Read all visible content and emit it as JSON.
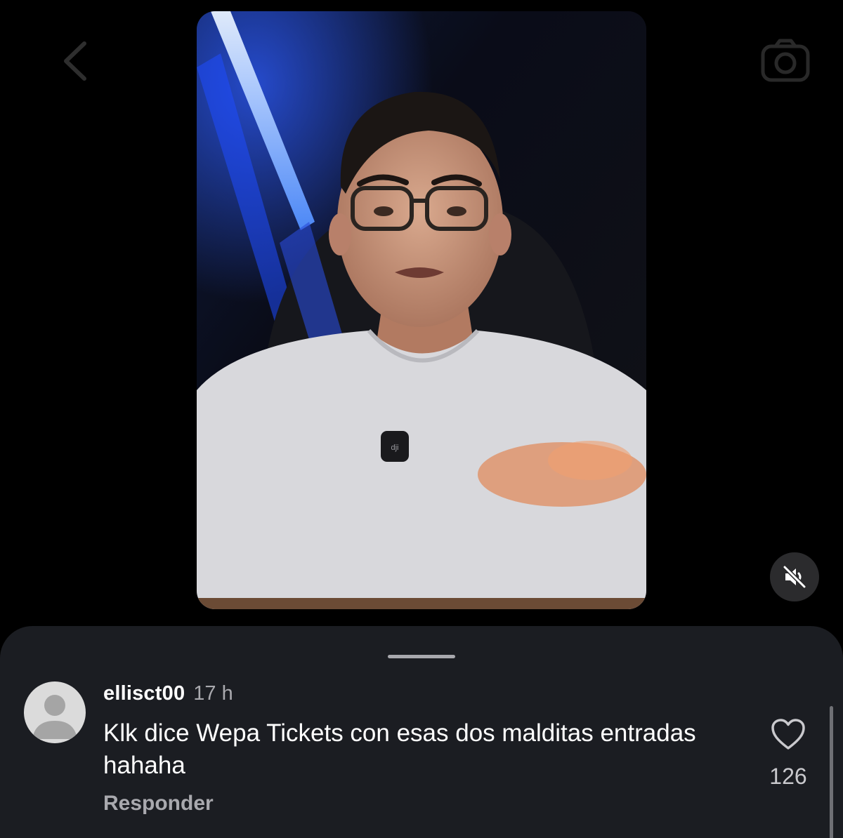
{
  "header": {
    "back_icon": "chevron-left-icon",
    "camera_icon": "camera-icon"
  },
  "video": {
    "muted": true,
    "mute_icon": "speaker-muted-icon"
  },
  "comment": {
    "username": "ellisct00",
    "timestamp": "17 h",
    "text": "Klk dice Wepa Tickets con esas dos malditas entradas hahaha",
    "reply_label": "Responder",
    "like_icon": "heart-outline-icon",
    "like_count": "126"
  },
  "colors": {
    "background": "#000000",
    "sheet": "#1b1d22",
    "secondary_text": "#a9a9ae"
  }
}
